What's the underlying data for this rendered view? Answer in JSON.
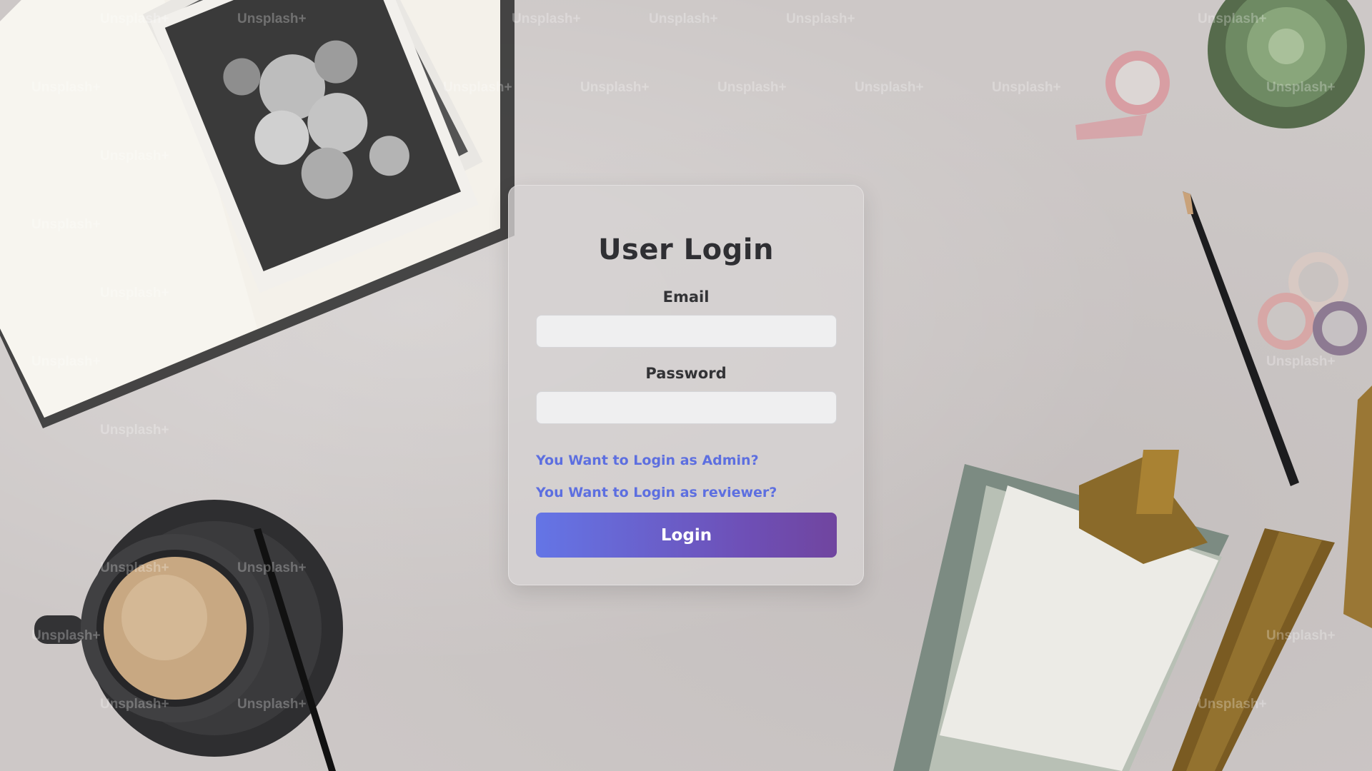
{
  "background": {
    "watermark_text": "Unsplash+",
    "palette": {
      "desk": "#cdc8c7",
      "notebook_page": "#f4f1ea",
      "coffee": "#c8a882",
      "succulent": "#6e8a63",
      "brass": "#8a6a2a"
    }
  },
  "login_card": {
    "title": "User Login",
    "email_label": "Email",
    "email_value": "",
    "password_label": "Password",
    "password_value": "",
    "admin_link": "You Want to Login as Admin?",
    "reviewer_link": "You Want to Login as reviewer?",
    "login_button": "Login"
  },
  "colors": {
    "link": "#5d6fe0",
    "button_gradient_start": "#6475e6",
    "button_gradient_end": "#70459f",
    "title": "#2f2f33"
  }
}
